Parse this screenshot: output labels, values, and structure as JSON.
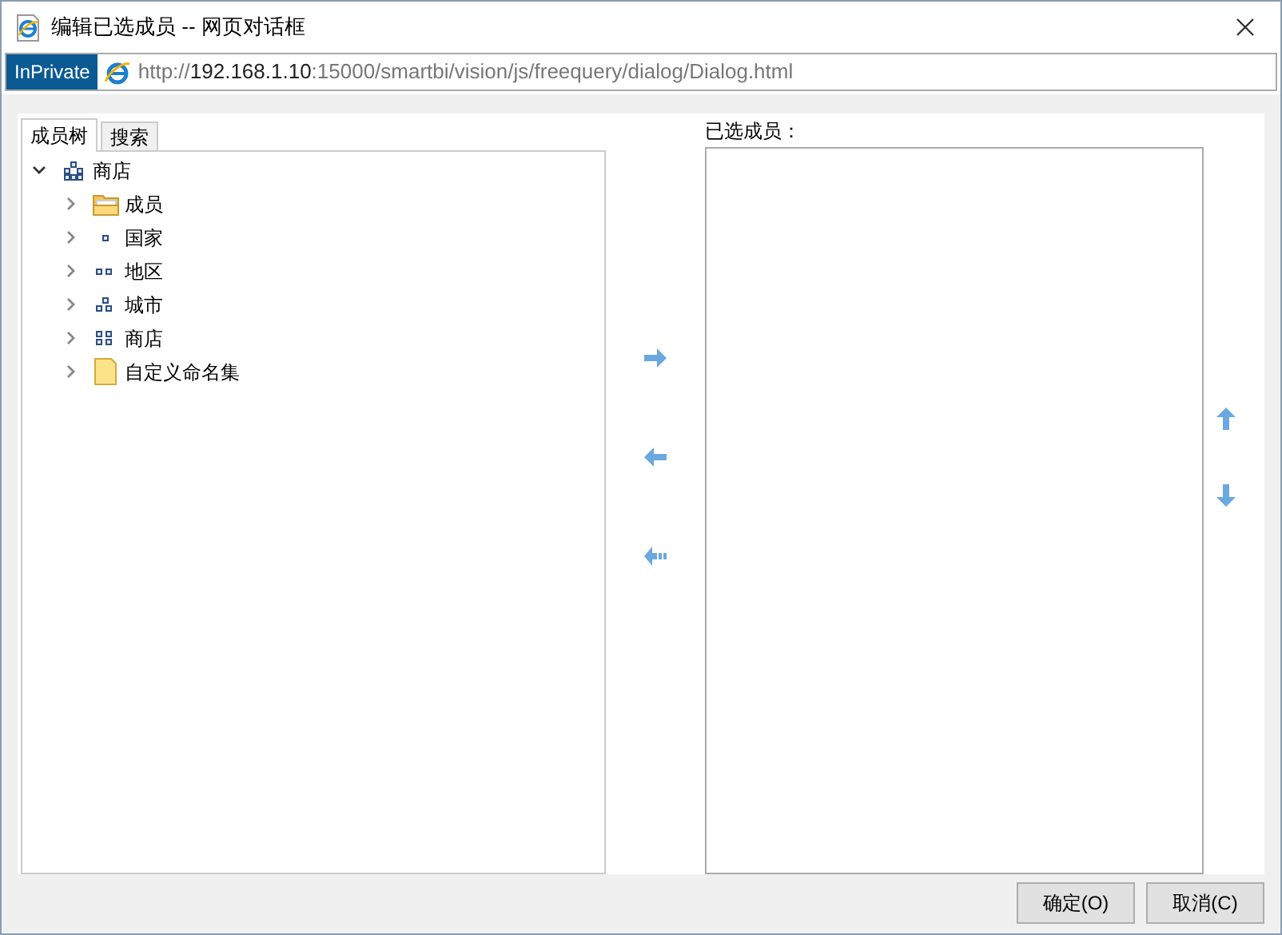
{
  "window": {
    "title": "编辑已选成员 -- 网页对话框"
  },
  "address_bar": {
    "badge": "InPrivate",
    "url_prefix": "http://",
    "url_host": "192.168.1.10",
    "url_path": ":15000/smartbi/vision/js/freequery/dialog/Dialog.html"
  },
  "tabs": [
    {
      "label": "成员树",
      "selected": true
    },
    {
      "label": "搜索",
      "selected": false
    }
  ],
  "tree": [
    {
      "label": "商店",
      "kind": "hierarchy",
      "expanded": true,
      "children": [
        {
          "label": "成员",
          "kind": "open-folder",
          "expanded": false
        },
        {
          "label": "国家",
          "kind": "level1",
          "expanded": false
        },
        {
          "label": "地区",
          "kind": "level2",
          "expanded": false
        },
        {
          "label": "城市",
          "kind": "level3",
          "expanded": false
        },
        {
          "label": "商店",
          "kind": "level4",
          "expanded": false
        },
        {
          "label": "自定义命名集",
          "kind": "folder",
          "expanded": false
        }
      ]
    }
  ],
  "selected_list": {
    "label": "已选成员："
  },
  "buttons": [
    "确定(O)",
    "取消(C)"
  ]
}
